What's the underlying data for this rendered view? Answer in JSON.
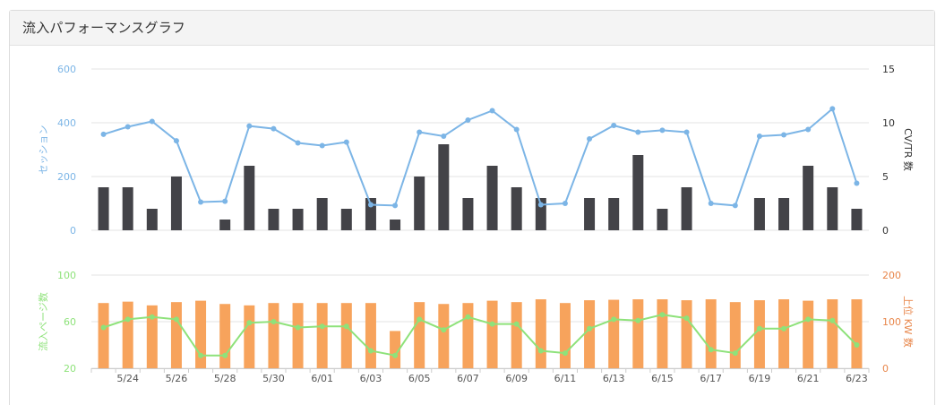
{
  "panel": {
    "title": "流入パフォーマンスグラフ"
  },
  "colors": {
    "session_line": "#7cb5e6",
    "cv_bar": "#434348",
    "pages_line": "#8ee27a",
    "kw_bar": "#f7a35c",
    "top_left_axis": "#7cb5e6",
    "bottom_left_axis": "#8ee27a",
    "bottom_right_axis": "#e8864a",
    "top_right_axis": "#333333"
  },
  "chart_data": [
    {
      "type": "bar+line",
      "x": [
        "5/23",
        "5/24",
        "5/25",
        "5/26",
        "5/27",
        "5/28",
        "5/29",
        "5/30",
        "5/31",
        "6/01",
        "6/02",
        "6/03",
        "6/04",
        "6/05",
        "6/06",
        "6/07",
        "6/08",
        "6/09",
        "6/10",
        "6/11",
        "6/12",
        "6/13",
        "6/14",
        "6/15",
        "6/16",
        "6/17",
        "6/18",
        "6/19",
        "6/20",
        "6/21",
        "6/22",
        "6/23"
      ],
      "ylabel_left": "セッション",
      "ylabel_right": "CV/TR 数",
      "ylim_left": [
        0,
        600
      ],
      "ylim_right": [
        0,
        15
      ],
      "yticks_left": [
        "0",
        "200",
        "400",
        "600"
      ],
      "yticks_right": [
        "0",
        "5",
        "10",
        "15"
      ],
      "series": [
        {
          "name": "セッション",
          "type": "line",
          "axis": "left",
          "values": [
            357,
            385,
            405,
            333,
            105,
            108,
            388,
            378,
            325,
            315,
            328,
            95,
            92,
            365,
            350,
            410,
            445,
            375,
            95,
            100,
            340,
            390,
            365,
            372,
            365,
            100,
            92,
            350,
            355,
            375,
            452,
            175
          ]
        },
        {
          "name": "CV/TR 数",
          "type": "bar",
          "axis": "right",
          "values": [
            4,
            4,
            2,
            5,
            0,
            1,
            6,
            2,
            2,
            3,
            2,
            3,
            1,
            5,
            8,
            3,
            6,
            4,
            3,
            0,
            3,
            3,
            7,
            2,
            4,
            0,
            0,
            3,
            3,
            6,
            4,
            2
          ]
        }
      ]
    },
    {
      "type": "bar+line",
      "x": [
        "5/23",
        "5/24",
        "5/25",
        "5/26",
        "5/27",
        "5/28",
        "5/29",
        "5/30",
        "5/31",
        "6/01",
        "6/02",
        "6/03",
        "6/04",
        "6/05",
        "6/06",
        "6/07",
        "6/08",
        "6/09",
        "6/10",
        "6/11",
        "6/12",
        "6/13",
        "6/14",
        "6/15",
        "6/16",
        "6/17",
        "6/18",
        "6/19",
        "6/20",
        "6/21",
        "6/22",
        "6/23"
      ],
      "xtick_labels": [
        "5/24",
        "5/26",
        "5/28",
        "5/30",
        "6/01",
        "6/03",
        "6/05",
        "6/07",
        "6/09",
        "6/11",
        "6/13",
        "6/15",
        "6/17",
        "6/19",
        "6/21",
        "6/23"
      ],
      "ylabel_left": "流入ページ数",
      "ylabel_right": "上位 KW 数",
      "ylim_left": [
        20,
        100
      ],
      "ylim_right": [
        0,
        200
      ],
      "yticks_left": [
        "20",
        "60",
        "100"
      ],
      "yticks_right": [
        "0",
        "100",
        "200"
      ],
      "series": [
        {
          "name": "流入ページ数",
          "type": "line",
          "axis": "left",
          "values": [
            55,
            62,
            64,
            62,
            31,
            31,
            59,
            60,
            55,
            56,
            56,
            35,
            31,
            62,
            53,
            64,
            58,
            58,
            35,
            33,
            54,
            62,
            61,
            66,
            63,
            36,
            33,
            54,
            54,
            62,
            61,
            40
          ]
        },
        {
          "name": "上位 KW 数",
          "type": "bar",
          "axis": "right",
          "values": [
            140,
            143,
            135,
            142,
            145,
            138,
            135,
            140,
            140,
            140,
            140,
            140,
            80,
            142,
            138,
            140,
            145,
            142,
            148,
            140,
            146,
            147,
            148,
            148,
            146,
            148,
            142,
            146,
            148,
            145,
            148,
            148
          ]
        }
      ]
    }
  ]
}
